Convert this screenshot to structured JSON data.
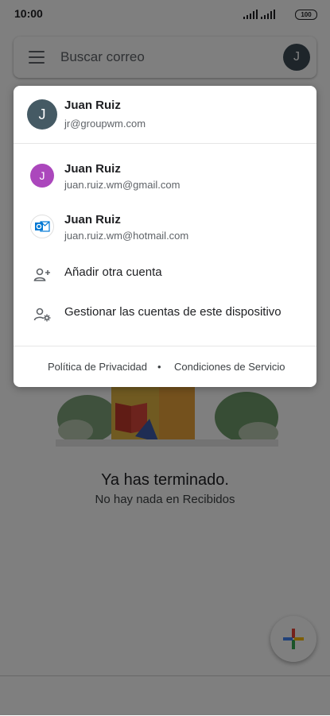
{
  "status_bar": {
    "time": "10:00",
    "battery": "100"
  },
  "search": {
    "placeholder": "Buscar correo",
    "avatar_initial": "J"
  },
  "empty_state": {
    "title": "Ya has terminado.",
    "subtitle": "No hay nada en Recibidos"
  },
  "account_menu": {
    "current_account": {
      "initial": "J",
      "name": "Juan Ruiz",
      "email": "jr@groupwm.com",
      "avatar_color": "#455a64"
    },
    "other_accounts": [
      {
        "initial": "J",
        "name": "Juan Ruiz",
        "email": "juan.ruiz.wm@gmail.com",
        "avatar_color": "#ab47bc",
        "icon": "gmail-avatar-icon"
      },
      {
        "name": "Juan Ruiz",
        "email": "juan.ruiz.wm@hotmail.com",
        "icon": "outlook-icon"
      }
    ],
    "actions": [
      {
        "label": "Añadir otra cuenta",
        "icon": "add-person-icon"
      },
      {
        "label": "Gestionar las cuentas de este dispositivo",
        "icon": "manage-accounts-icon"
      }
    ],
    "footer": {
      "privacy": "Política de Privacidad",
      "separator": "•",
      "terms": "Condiciones de Servicio"
    }
  },
  "colors": {
    "scrim": "#000000",
    "accent_outlook": "#0078d4"
  }
}
